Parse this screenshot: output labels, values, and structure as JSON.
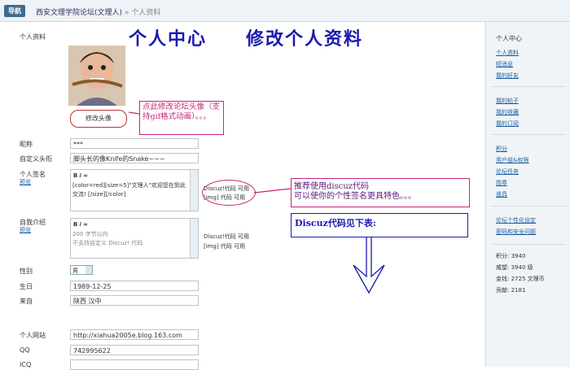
{
  "nav": {
    "button": "导航",
    "forum": "西安文理学院论坛(文理人)",
    "sep": "»",
    "current": "个人资料"
  },
  "left_title": "个人资料",
  "big_title": "个人中心　　修改个人资料",
  "avatar_button": "修改头像",
  "callout_avatar": "点此修改论坛头像（支持gif格式动画）。。。",
  "callout_sig": "推荐使用discuz代码\n可以使你的个性签名更具特色。。。",
  "callout_code": "Discuz代码见下表:",
  "fields": {
    "nickname_label": "昵称",
    "nickname_value": "***",
    "title_label": "自定义头衔",
    "title_value": "脚头长的像Knife的Snake~~~",
    "sig_label": "个人签名",
    "sig_preview": "预览",
    "sig_toolbar": "B  𝐼  ∞",
    "sig_value": "[color=red][size=5]\"文理人\"欢迎您在到此交流! [/size][/color]",
    "sig_hint1": "Discuz!代码 可用",
    "sig_hint2": "[img] 代码 可用",
    "intro_label": "自我介绍",
    "intro_preview": "预览",
    "intro_toolbar": "B  𝐼  ∞",
    "intro_value1": "200 字节以内",
    "intro_value2": "不支持自定义 Discuz! 代码",
    "intro_hint1": "Discuz!代码 可用",
    "intro_hint2": "[img] 代码 可用",
    "gender_label": "性别",
    "gender_value": "男",
    "birthday_label": "生日",
    "birthday_value": "1989-12-25",
    "from_label": "来自",
    "from_value": "陕西 汉中",
    "homepage_label": "个人网站",
    "homepage_value": "http://xiahua2005e.blog.163.com",
    "qq_label": "QQ",
    "qq_value": "742995622",
    "icq_label": "ICQ"
  },
  "side": {
    "title": "个人中心",
    "links1": [
      "个人资料",
      "短消息",
      "我的好友"
    ],
    "links2": [
      "我的帖子",
      "我的收藏",
      "我的订阅"
    ],
    "links3": [
      "积分",
      "用户组&权限",
      "论坛任务",
      "勋章",
      "道具"
    ],
    "links4": [
      "论坛个性化设定",
      "密码和安全问题"
    ],
    "stats": [
      "积分: 3940",
      "威望: 3940 级",
      "金钱: 2725 文理币",
      "贡献: 2181"
    ]
  }
}
